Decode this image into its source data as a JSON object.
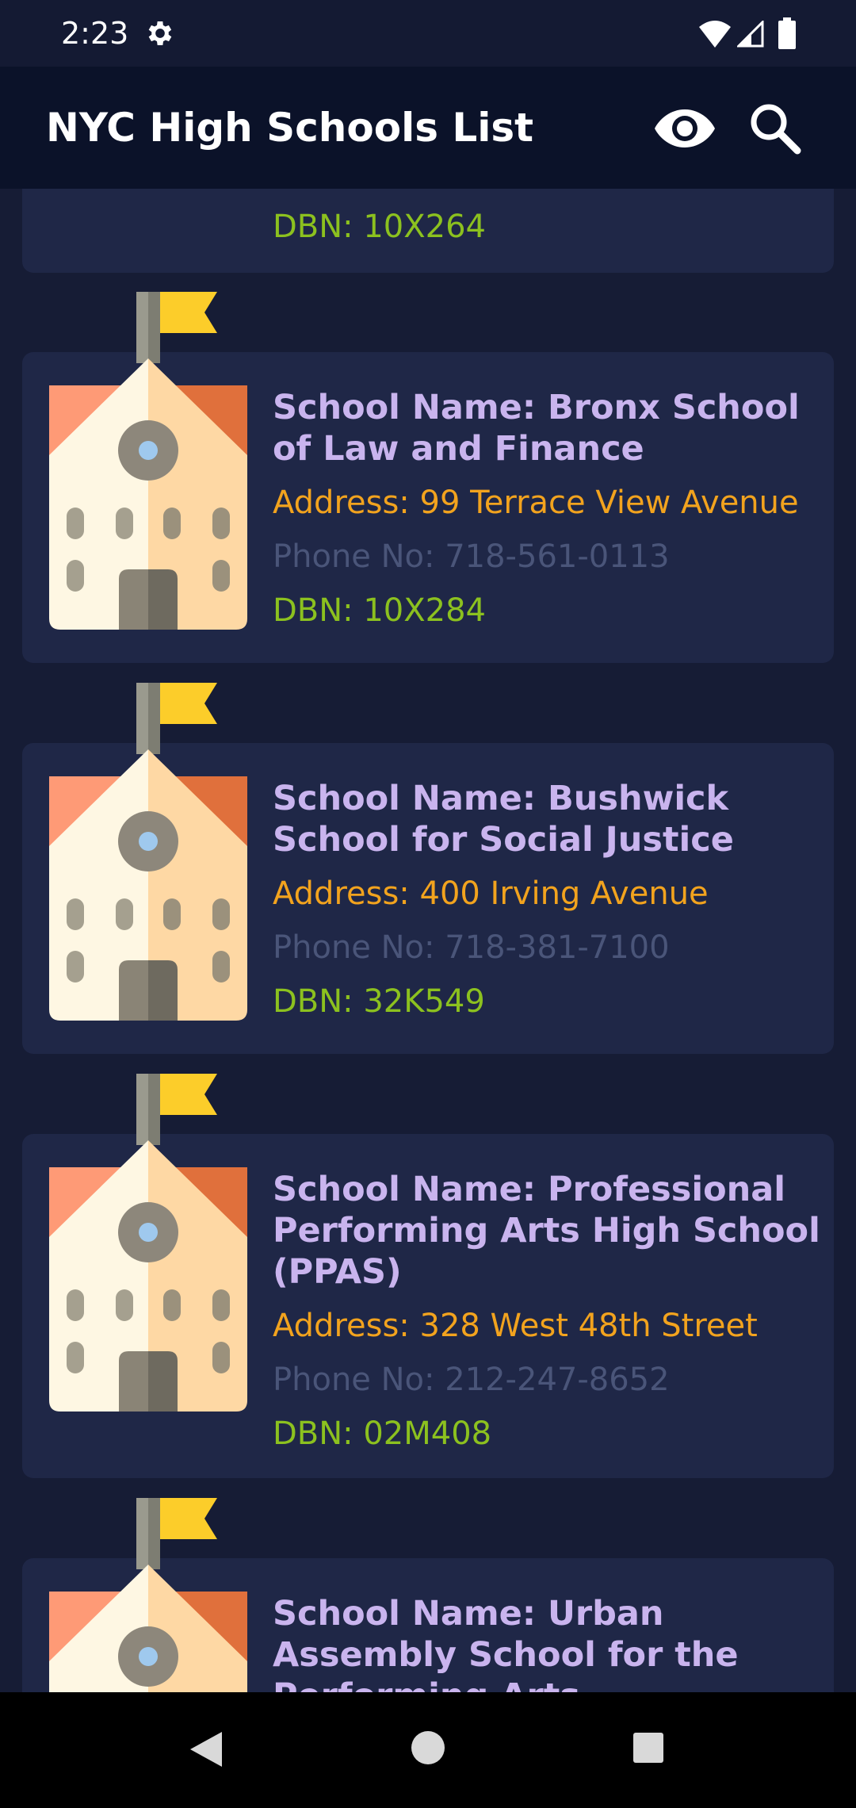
{
  "status_bar": {
    "time": "2:23",
    "icons": [
      "gear-icon",
      "wifi-icon",
      "signal-icon",
      "battery-icon"
    ]
  },
  "app_bar": {
    "title": "NYC High Schools List",
    "actions": [
      "eye-icon",
      "search-icon"
    ]
  },
  "schools": [
    {
      "name": "",
      "address": "",
      "phone": "",
      "dbn": "DBN: 10X264"
    },
    {
      "name": "School Name: Bronx School of Law and Finance",
      "address": "Address: 99 Terrace View Avenue",
      "phone": "Phone No: 718-561-0113",
      "dbn": "DBN: 10X284"
    },
    {
      "name": "School Name: Bushwick School for Social Justice",
      "address": "Address: 400 Irving Avenue",
      "phone": "Phone No: 718-381-7100",
      "dbn": "DBN: 32K549"
    },
    {
      "name": "School Name: Professional Performing Arts High School (PPAS)",
      "address": "Address: 328 West 48th Street",
      "phone": "Phone No: 212-247-8652",
      "dbn": "DBN: 02M408"
    },
    {
      "name": "School Name: Urban Assembly School for the Performing Arts",
      "address": "",
      "phone": "",
      "dbn": ""
    }
  ],
  "colors": {
    "background": "#161c35",
    "card": "#1f2747",
    "app_bar": "#0b1229",
    "name": "#c9b4ee",
    "address": "#f2a31e",
    "phone": "#4a5579",
    "dbn": "#8cc11f"
  },
  "nav_bar": {
    "icons": [
      "back-icon",
      "home-icon",
      "recents-icon"
    ]
  }
}
